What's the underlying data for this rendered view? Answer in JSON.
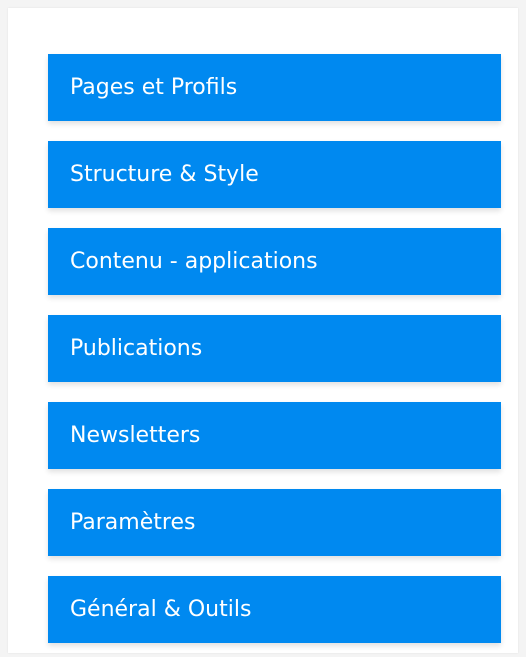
{
  "menu": {
    "items": [
      {
        "label": "Pages et Profils"
      },
      {
        "label": "Structure & Style"
      },
      {
        "label": "Contenu - applications"
      },
      {
        "label": "Publications"
      },
      {
        "label": "Newsletters"
      },
      {
        "label": "Paramètres"
      },
      {
        "label": "Général & Outils"
      }
    ]
  },
  "colors": {
    "accent": "#0089f0",
    "text": "#ffffff",
    "panel_bg": "#ffffff",
    "page_bg": "#f4f4f4"
  }
}
